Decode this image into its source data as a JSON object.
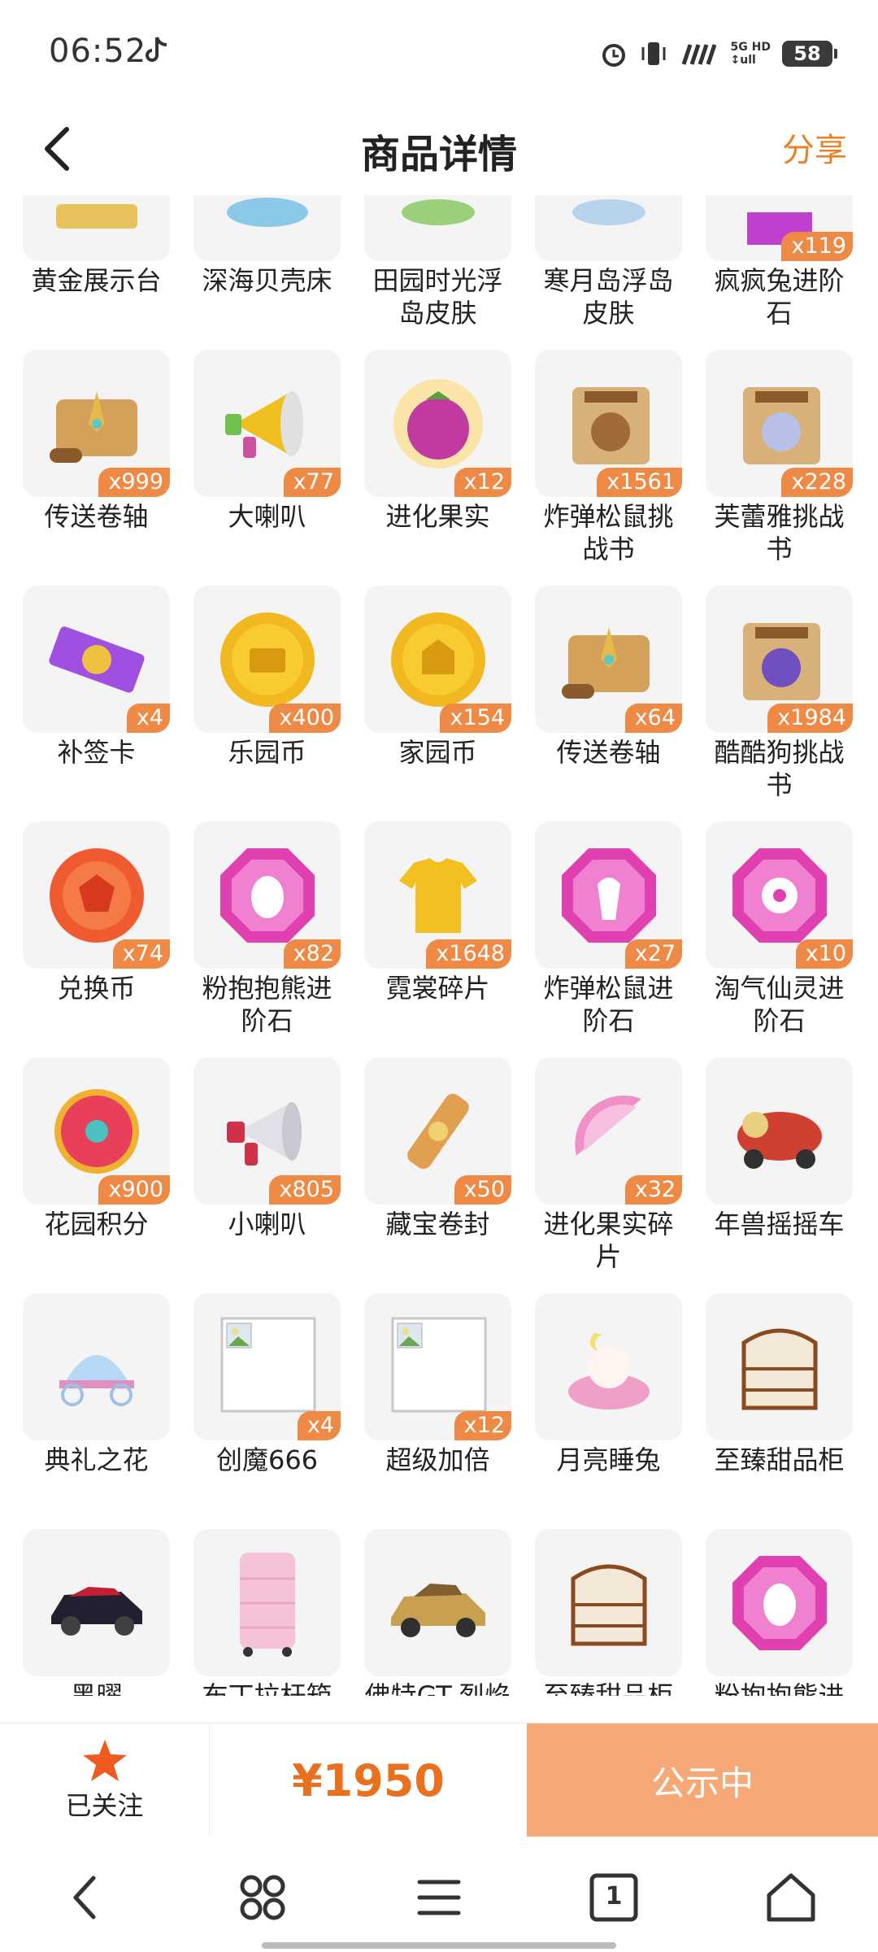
{
  "status": {
    "time": "06:52",
    "battery": "58",
    "network_top": "5G HD",
    "network_bottom": "↕ull"
  },
  "header": {
    "title": "商品详情",
    "share": "分享"
  },
  "items": [
    {
      "name": "黄金展示台",
      "qty": ""
    },
    {
      "name": "深海贝壳床",
      "qty": ""
    },
    {
      "name": "田园时光浮岛皮肤",
      "qty": ""
    },
    {
      "name": "寒月岛浮岛皮肤",
      "qty": ""
    },
    {
      "name": "疯疯兔进阶石",
      "qty": "x119"
    },
    {
      "name": "传送卷轴",
      "qty": "x999"
    },
    {
      "name": "大喇叭",
      "qty": "x77"
    },
    {
      "name": "进化果实",
      "qty": "x12"
    },
    {
      "name": "炸弹松鼠挑战书",
      "qty": "x1561"
    },
    {
      "name": "芙蕾雅挑战书",
      "qty": "x228"
    },
    {
      "name": "补签卡",
      "qty": "x4"
    },
    {
      "name": "乐园币",
      "qty": "x400"
    },
    {
      "name": "家园币",
      "qty": "x154"
    },
    {
      "name": "传送卷轴",
      "qty": "x64"
    },
    {
      "name": "酷酷狗挑战书",
      "qty": "x1984"
    },
    {
      "name": "兑换币",
      "qty": "x74"
    },
    {
      "name": "粉抱抱熊进阶石",
      "qty": "x82"
    },
    {
      "name": "霓裳碎片",
      "qty": "x1648"
    },
    {
      "name": "炸弹松鼠进阶石",
      "qty": "x27"
    },
    {
      "name": "淘气仙灵进阶石",
      "qty": "x10"
    },
    {
      "name": "花园积分",
      "qty": "x900"
    },
    {
      "name": "小喇叭",
      "qty": "x805"
    },
    {
      "name": "藏宝卷封",
      "qty": "x50"
    },
    {
      "name": "进化果实碎片",
      "qty": "x32"
    },
    {
      "name": "年兽摇摇车",
      "qty": ""
    },
    {
      "name": "典礼之花",
      "qty": ""
    },
    {
      "name": "创魔666",
      "qty": "x4"
    },
    {
      "name": "超级加倍",
      "qty": "x12"
    },
    {
      "name": "月亮睡兔",
      "qty": ""
    },
    {
      "name": "至臻甜品柜",
      "qty": ""
    },
    {
      "name": "黑曜",
      "qty": ""
    },
    {
      "name": "布丁拉杆箱",
      "qty": ""
    },
    {
      "name": "佛特GT-烈焰II",
      "qty": ""
    },
    {
      "name": "至臻甜品柜",
      "qty": ""
    },
    {
      "name": "粉抱抱熊进阶石",
      "qty": ""
    }
  ],
  "action": {
    "follow_label": "已关注",
    "price": "¥1950",
    "status_label": "公示中"
  },
  "colors": {
    "accent": "#e8822a",
    "price": "#e8701e",
    "status_btn": "#f7a877",
    "badge": "#ee8a45",
    "tile_bg": "#f4f4f4"
  },
  "nav": {
    "tabs_count": "1"
  }
}
